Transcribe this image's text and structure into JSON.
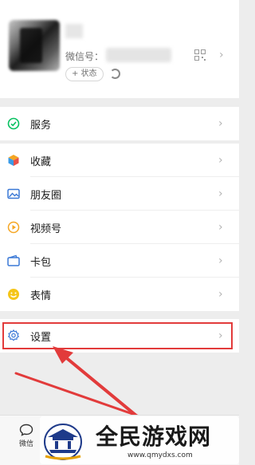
{
  "profile": {
    "wechat_id_label": "微信号：",
    "status_button": "+ 状态",
    "chevron": "›"
  },
  "menu": {
    "service": {
      "label": "服务",
      "icon": "service-icon",
      "color": "#07c160"
    },
    "favorites": {
      "label": "收藏",
      "icon": "favorites-cube-icon",
      "color": "#f5a623"
    },
    "moments": {
      "label": "朋友圈",
      "icon": "moments-photo-icon",
      "color": "#3a78d6"
    },
    "channels": {
      "label": "视频号",
      "icon": "channels-play-icon",
      "color": "#f5a623"
    },
    "cards": {
      "label": "卡包",
      "icon": "card-wallet-icon",
      "color": "#3a78d6"
    },
    "stickers": {
      "label": "表情",
      "icon": "sticker-smile-icon",
      "color": "#f5c518"
    },
    "settings": {
      "label": "设置",
      "icon": "settings-gear-icon",
      "color": "#3a78d6"
    },
    "chevron": "›"
  },
  "tabbar": {
    "chats_label": "微信"
  },
  "watermark": {
    "title": "全民游戏网",
    "url": "www.qmydxs.com"
  },
  "annotation_color": "#e23b3b"
}
